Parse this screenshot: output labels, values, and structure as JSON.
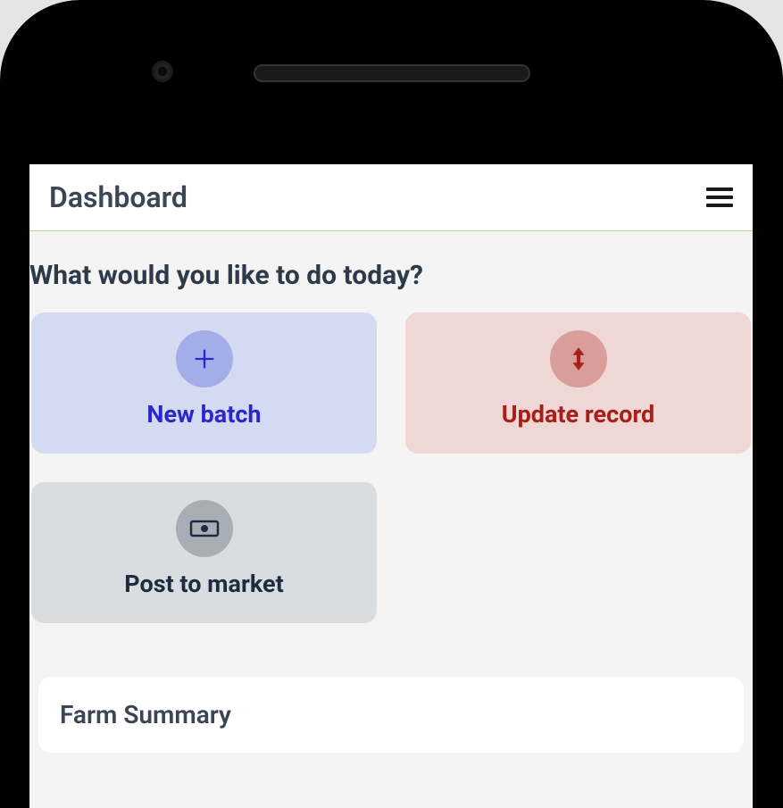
{
  "header": {
    "title": "Dashboard"
  },
  "prompt": "What would you like to do today?",
  "actions": {
    "new_batch": {
      "label": "New batch"
    },
    "update_record": {
      "label": "Update record"
    },
    "post_to_market": {
      "label": "Post to market"
    }
  },
  "summary": {
    "title": "Farm Summary"
  }
}
